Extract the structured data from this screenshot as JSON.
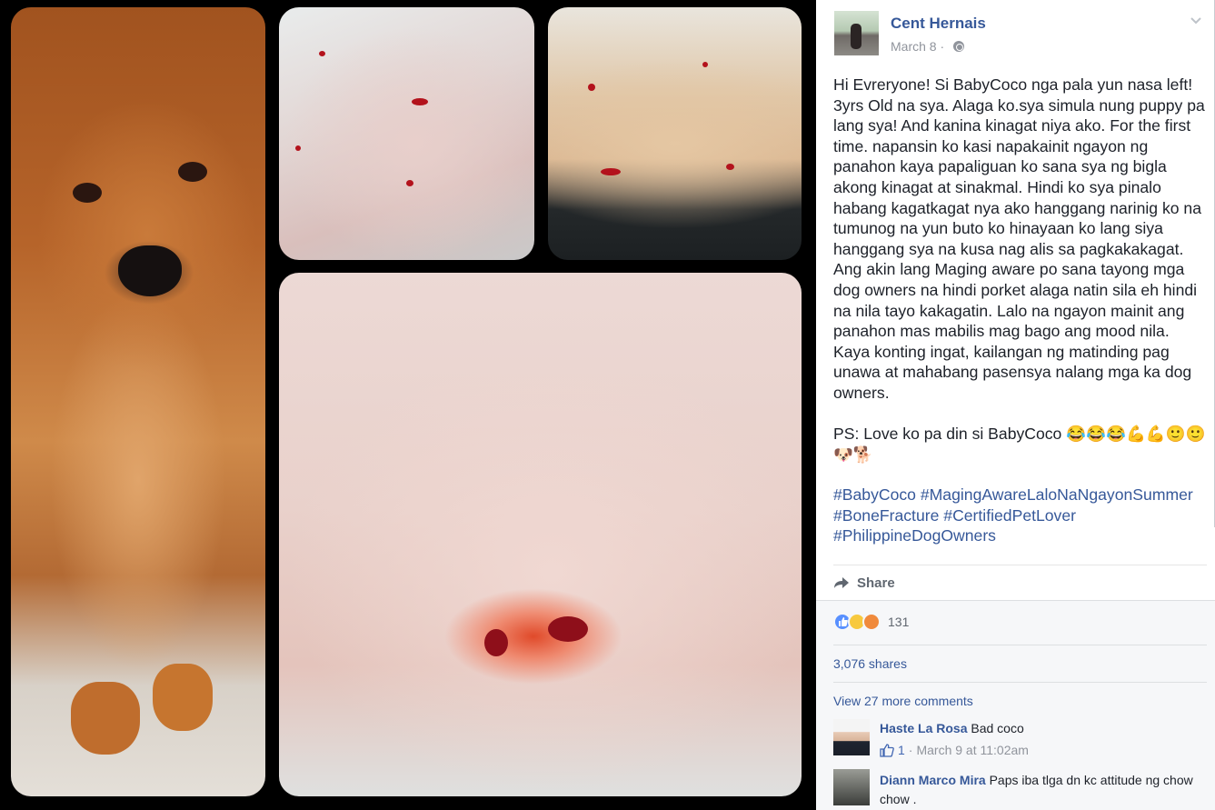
{
  "post": {
    "author": "Cent Hernais",
    "date": "March 8",
    "date_separator": "·",
    "paragraphs": [
      "Hi Evreryone! Si BabyCoco nga pala yun nasa left! 3yrs Old na sya. Alaga ko.sya simula nung puppy pa lang sya! And kanina kinagat niya ako. For the first time. napansin ko kasi napakainit ngayon ng panahon kaya papaliguan ko sana sya ng bigla akong kinagat at sinakmal. Hindi ko sya pinalo habang kagatkagat nya ako hanggang narinig ko na tumunog na yun buto ko hinayaan ko lang siya hanggang sya na kusa nag alis sa pagkakakagat. Ang akin lang Maging aware po sana tayong mga dog owners na hindi porket alaga natin sila eh hindi na nila tayo kakagatin. Lalo na ngayon mainit ang panahon mas mabilis mag bago ang mood nila. Kaya konting ingat, kailangan ng matinding pag unawa at mahabang pasensya nalang mga ka dog owners.",
      "PS: Love ko pa din si BabyCoco 😂😂😂💪💪🙂🙂🐶🐕"
    ],
    "hashtags": [
      "#BabyCoco",
      "#MagingAwareLaloNaNgayonSummer",
      "#BoneFracture",
      "#CertifiedPetLover",
      "#PhilippineDogOwners"
    ]
  },
  "actions": {
    "share_label": "Share"
  },
  "feedback": {
    "reaction_count": "131",
    "shares": "3,076 shares",
    "view_more": "View 27 more comments"
  },
  "comments": [
    {
      "author": "Haste La Rosa",
      "text": "Bad coco",
      "likes": "1",
      "meta_separator": "·",
      "time": "March 9 at 11:02am"
    },
    {
      "author": "Diann Marco Mira",
      "text": "Paps iba tlga dn kc attitude ng chow chow ."
    }
  ],
  "icons": {
    "globe": "globe-icon",
    "chevron": "chevron-down-icon",
    "share": "share-icon",
    "reactions": [
      "like-reaction-icon",
      "sad-reaction-icon",
      "angry-reaction-icon"
    ],
    "comment_like": "thumbs-up-icon"
  },
  "colors": {
    "link": "#365899",
    "text": "#1d2129",
    "muted": "#90949c",
    "feedback_bg": "#f6f7f9"
  }
}
